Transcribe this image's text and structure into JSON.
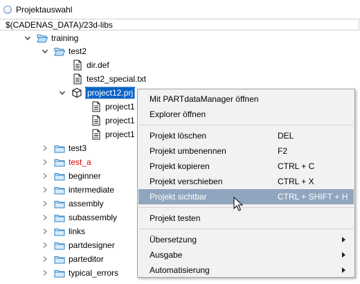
{
  "window": {
    "title": "Projektauswahl",
    "path": "$(CADENAS_DATA)/23d-libs"
  },
  "colors": {
    "selection": "#0a64c8",
    "menu_highlight": "#90a6bf",
    "red_item": "#e00000"
  },
  "tree": {
    "training": "training",
    "test2": "test2",
    "dir_def": "dir.def",
    "test2_special": "test2_special.txt",
    "project12": "project12.prj",
    "proj_child_1": "project1",
    "proj_child_2": "project1",
    "proj_child_3": "project1",
    "test3": "test3",
    "test_a": "test_a",
    "beginner": "beginner",
    "intermediate": "intermediate",
    "assembly": "assembly",
    "subassembly": "subassembly",
    "links": "links",
    "partdesigner": "partdesigner",
    "parteditor": "parteditor",
    "typical_errors": "typical_errors"
  },
  "menu": {
    "open_pdm": "Mit PARTdataManager öffnen",
    "explorer": "Explorer öffnen",
    "delete": "Projekt löschen",
    "delete_sc": "DEL",
    "rename": "Projekt umbenennen",
    "rename_sc": "F2",
    "copy": "Projekt kopieren",
    "copy_sc": "CTRL + C",
    "move": "Projekt verschieben",
    "move_sc": "CTRL + X",
    "visible": "Projekt sichtbar",
    "visible_sc": "CTRL + SHIFT + H",
    "test": "Projekt testen",
    "translation": "Übersetzung",
    "output": "Ausgabe",
    "automation": "Automatisierung"
  }
}
